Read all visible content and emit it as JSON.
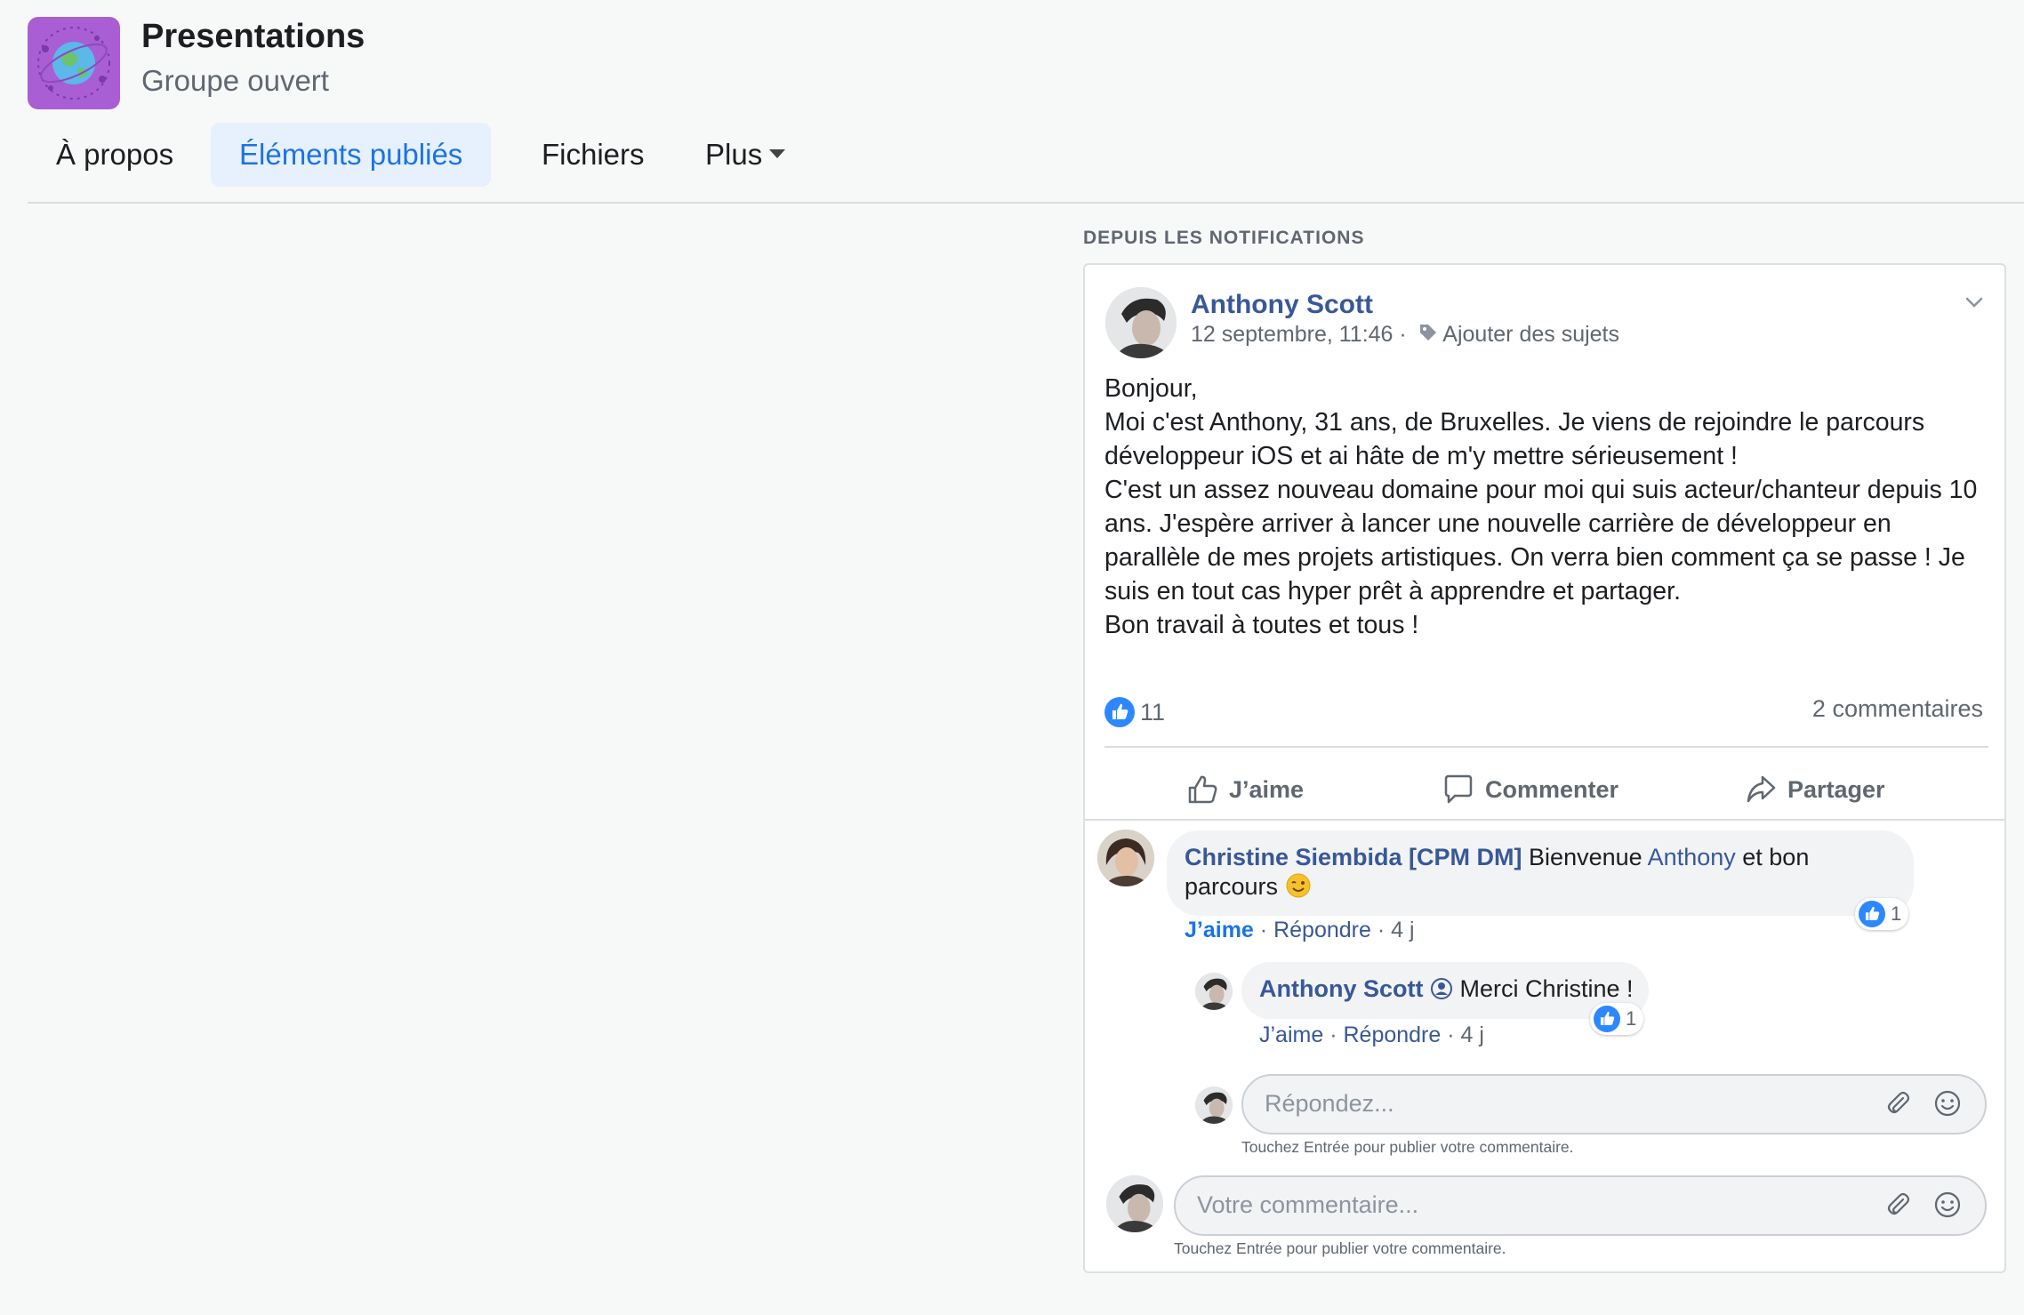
{
  "group": {
    "title": "Presentations",
    "subtitle": "Groupe ouvert",
    "icon": "globe-icon"
  },
  "tabs": [
    {
      "label": "À propos",
      "active": false
    },
    {
      "label": "Éléments publiés",
      "active": true
    },
    {
      "label": "Fichiers",
      "active": false
    },
    {
      "label": "Plus",
      "active": false
    }
  ],
  "section_label": "DEPUIS LES NOTIFICATIONS",
  "post": {
    "author": "Anthony Scott",
    "date": "12 septembre, 11:46",
    "separator": "·",
    "add_topics": "Ajouter des sujets",
    "body": "Bonjour,\nMoi c'est Anthony, 31 ans, de Bruxelles. Je viens de rejoindre le parcours développeur iOS et ai hâte de m'y mettre sérieusement !\nC'est un assez nouveau domaine pour moi qui suis acteur/chanteur depuis 10 ans. J'espère arriver à lancer une nouvelle carrière de développeur en parallèle de mes projets artistiques. On verra bien comment ça se passe ! Je suis en tout cas hyper prêt à apprendre et partager.\nBon travail à toutes et tous !",
    "like_count": "11",
    "comments_count": "2 commentaires",
    "actions": {
      "like": "J’aime",
      "comment": "Commenter",
      "share": "Partager"
    }
  },
  "comments": [
    {
      "author": "Christine Siembida [CPM DM]",
      "text_before": "Bienvenue",
      "mention": "Anthony",
      "text_after": "et bon parcours",
      "emoji": "😉",
      "like": "J’aime",
      "reply": "Répondre",
      "time": "4 j",
      "reaction_count": "1"
    }
  ],
  "reply": {
    "author": "Anthony Scott",
    "text": "Merci Christine !",
    "like": "J’aime",
    "reply": "Répondre",
    "time": "4 j",
    "reaction_count": "1"
  },
  "reply_input": {
    "placeholder": "Répondez...",
    "hint": "Touchez Entrée pour publier votre commentaire."
  },
  "comment_input": {
    "placeholder": "Votre commentaire...",
    "hint": "Touchez Entrée pour publier votre commentaire."
  },
  "colors": {
    "link": "#385898",
    "accent": "#1b74e4",
    "like": "#2d88ff",
    "group_icon": "#a95ed4"
  }
}
